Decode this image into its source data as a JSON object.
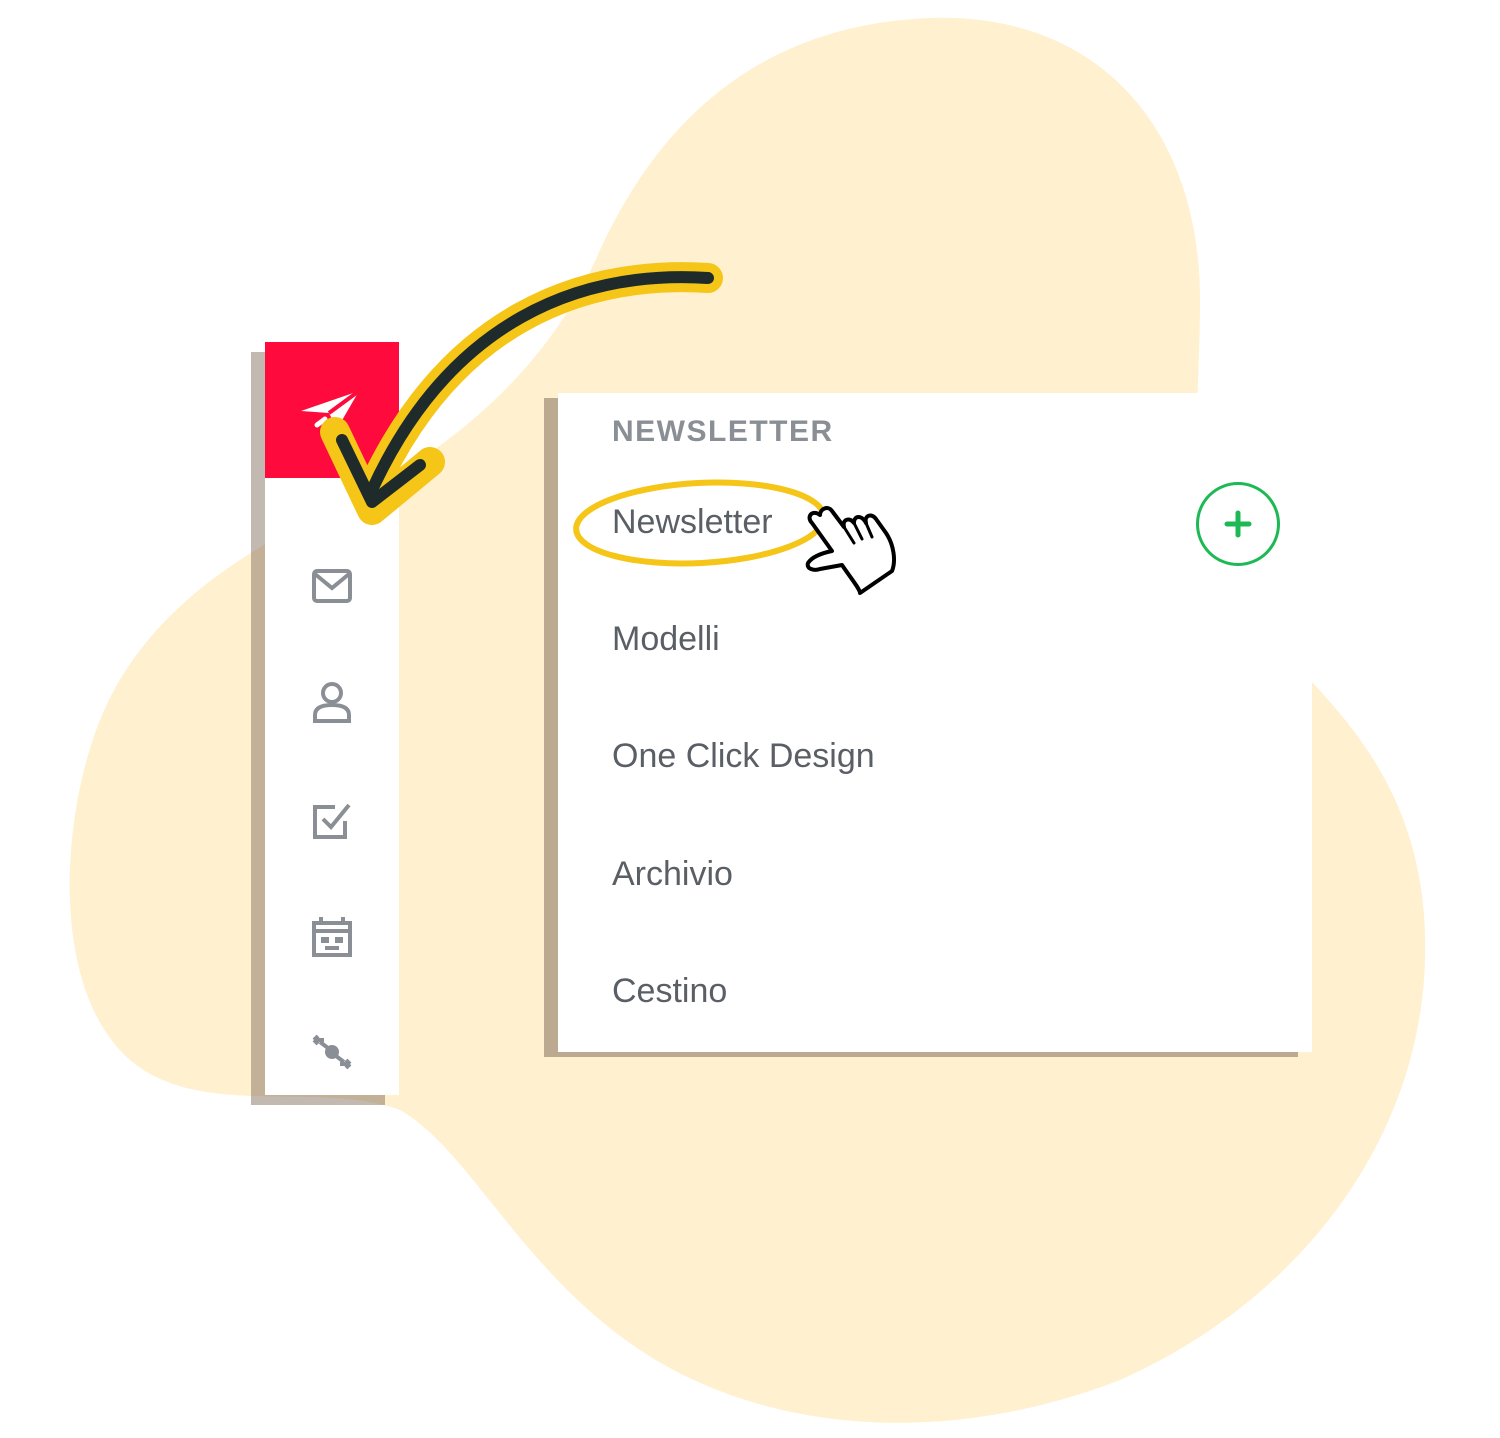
{
  "colors": {
    "brand": "#ff0a3c",
    "blob": "#fff0d0",
    "highlight": "#f5c518",
    "add": "#1db954",
    "icon": "#8a8f96",
    "text": "#5a5f66"
  },
  "sidebar": {
    "logo_icon": "paper-plane-icon",
    "items": [
      {
        "icon": "envelope-icon"
      },
      {
        "icon": "user-icon"
      },
      {
        "icon": "checkbox-icon"
      },
      {
        "icon": "calendar-robot-icon"
      },
      {
        "icon": "transfer-icon"
      }
    ]
  },
  "panel": {
    "title": "NEWSLETTER",
    "items": [
      {
        "label": "Newsletter"
      },
      {
        "label": "Modelli"
      },
      {
        "label": "One Click Design"
      },
      {
        "label": "Archivio"
      },
      {
        "label": "Cestino"
      }
    ],
    "add_icon": "plus-circle-icon"
  },
  "annotations": {
    "arrow": "curved-arrow",
    "highlight": "ellipse-around-newsletter",
    "cursor": "hand-pointer-icon"
  }
}
